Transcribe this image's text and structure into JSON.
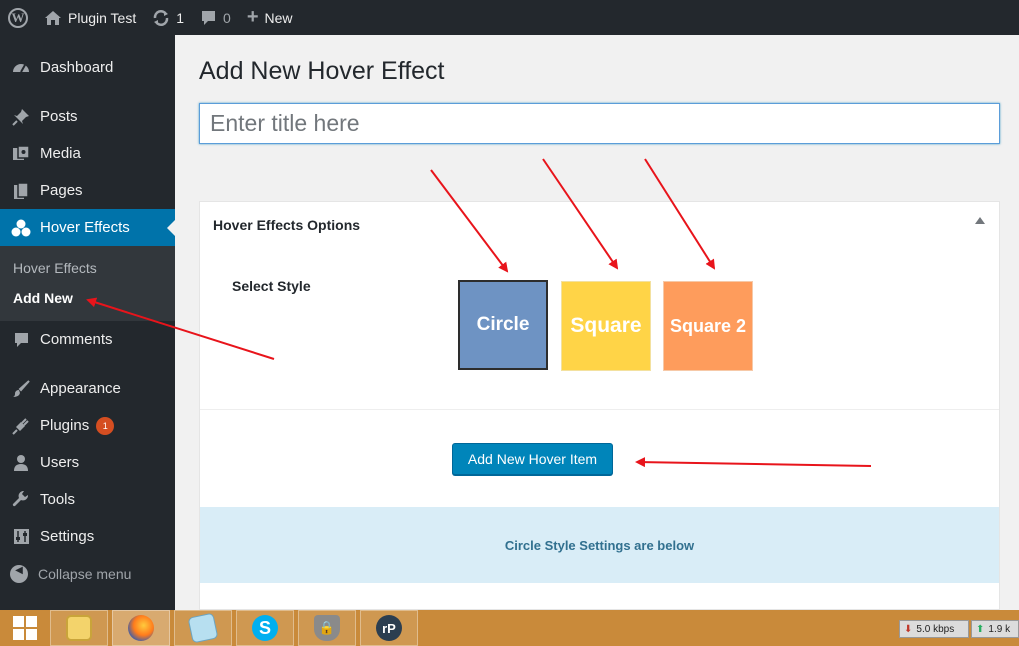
{
  "admin_bar": {
    "site_name": "Plugin Test",
    "updates_count": "1",
    "comments_count": "0",
    "new_label": "New"
  },
  "sidebar": {
    "items": [
      {
        "label": "Dashboard",
        "icon": "dashboard-icon"
      },
      {
        "label": "Posts",
        "icon": "pin-icon"
      },
      {
        "label": "Media",
        "icon": "media-icon"
      },
      {
        "label": "Pages",
        "icon": "pages-icon"
      },
      {
        "label": "Hover Effects",
        "icon": "hover-effects-icon"
      },
      {
        "label": "Comments",
        "icon": "comment-icon"
      },
      {
        "label": "Appearance",
        "icon": "paintbrush-icon"
      },
      {
        "label": "Plugins",
        "icon": "plugin-icon"
      },
      {
        "label": "Users",
        "icon": "users-icon"
      },
      {
        "label": "Tools",
        "icon": "wrench-icon"
      },
      {
        "label": "Settings",
        "icon": "settings-icon"
      }
    ],
    "submenu": [
      {
        "label": "Hover Effects"
      },
      {
        "label": "Add New"
      }
    ],
    "plugins_badge": "1",
    "collapse_label": "Collapse menu"
  },
  "page": {
    "title": "Add New Hover Effect",
    "title_placeholder": "Enter title here"
  },
  "metabox": {
    "title": "Hover Effects Options",
    "select_style_label": "Select Style",
    "styles": [
      "Circle",
      "Square",
      "Square 2"
    ],
    "add_button_label": "Add New Hover Item",
    "settings_note": "Circle Style Settings are below"
  },
  "taskbar": {
    "download_speed": "5.0 kbps",
    "upload_speed": "1.9 k"
  },
  "colors": {
    "admin_dark": "#23282d",
    "accent": "#0073aa",
    "circle_tile": "#6e93c3",
    "square_tile": "#ffd447",
    "square2_tile": "#fe9c5c",
    "annotation_arrow": "#e8141b"
  }
}
